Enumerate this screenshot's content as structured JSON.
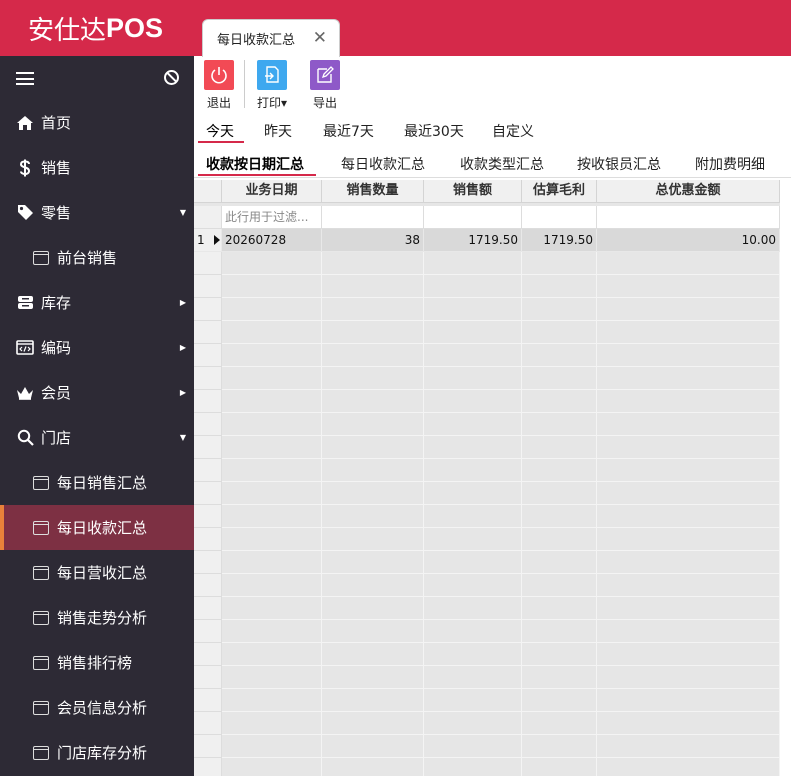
{
  "header": {
    "brand_cn": "安仕达",
    "brand_en": "POS",
    "tab_title": "每日收款汇总",
    "tab_close": "✕"
  },
  "sidebar": {
    "items": [
      {
        "label": "首页",
        "icon": "home-icon"
      },
      {
        "label": "销售",
        "icon": "dollar-icon"
      },
      {
        "label": "零售",
        "icon": "tag-icon",
        "arrow": "▼"
      },
      {
        "label": "前台销售",
        "icon": "window-icon",
        "sub": true
      },
      {
        "label": "库存",
        "icon": "storage-icon",
        "arrow": "▶"
      },
      {
        "label": "编码",
        "icon": "code-icon",
        "arrow": "▶"
      },
      {
        "label": "会员",
        "icon": "crown-icon",
        "arrow": "▶"
      },
      {
        "label": "门店",
        "icon": "search-icon",
        "arrow": "▼"
      },
      {
        "label": "每日销售汇总",
        "icon": "window-icon",
        "sub": true
      },
      {
        "label": "每日收款汇总",
        "icon": "window-icon",
        "sub": true,
        "active": true
      },
      {
        "label": "每日营收汇总",
        "icon": "window-icon",
        "sub": true
      },
      {
        "label": "销售走势分析",
        "icon": "window-icon",
        "sub": true
      },
      {
        "label": "销售排行榜",
        "icon": "window-icon",
        "sub": true
      },
      {
        "label": "会员信息分析",
        "icon": "window-icon",
        "sub": true
      },
      {
        "label": "门店库存分析",
        "icon": "window-icon",
        "sub": true
      }
    ]
  },
  "toolbar": {
    "exit_label": "退出",
    "print_label": "打印",
    "print_arrow": "▾",
    "export_label": "导出",
    "colors": {
      "exit": "#f24a55",
      "print": "#3ea8ef",
      "export": "#8e59c8"
    }
  },
  "date_tabs": [
    "今天",
    "昨天",
    "最近7天",
    "最近30天",
    "自定义"
  ],
  "sub_tabs": [
    "收款按日期汇总",
    "每日收款汇总",
    "收款类型汇总",
    "按收银员汇总",
    "附加费明细"
  ],
  "grid": {
    "columns": [
      "业务日期",
      "销售数量",
      "销售额",
      "估算毛利",
      "总优惠金额"
    ],
    "filter_placeholder": "此行用于过滤...",
    "rows": [
      {
        "num": "1",
        "date": "20260728",
        "qty": "38",
        "sales": "1719.50",
        "profit": "1719.50",
        "discount": "10.00"
      }
    ]
  },
  "accent": "#d5294a"
}
